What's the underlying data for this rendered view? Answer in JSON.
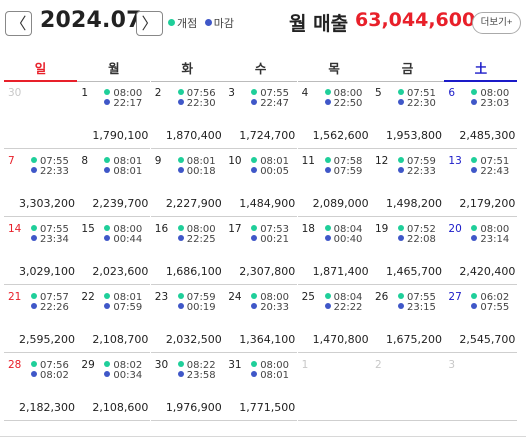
{
  "header": {
    "prev_label": "〈",
    "next_label": "〉",
    "month": "2024.07",
    "legend": {
      "open_label": "개점",
      "close_label": "마감",
      "open_color": "#1fcf9a",
      "close_color": "#3f57c8"
    },
    "sales_label": "월 매출",
    "sales_value": "63,044,600",
    "more_label": "더보기+"
  },
  "weekdays": [
    "일",
    "월",
    "화",
    "수",
    "목",
    "금",
    "土"
  ],
  "weeks": [
    [
      {
        "day": "30",
        "other": true
      },
      {
        "day": "1",
        "open": "08:00",
        "close": "22:17",
        "amount": "1,790,100"
      },
      {
        "day": "2",
        "open": "07:56",
        "close": "22:30",
        "amount": "1,870,400"
      },
      {
        "day": "3",
        "open": "07:55",
        "close": "22:47",
        "amount": "1,724,700"
      },
      {
        "day": "4",
        "open": "08:00",
        "close": "22:50",
        "amount": "1,562,600"
      },
      {
        "day": "5",
        "open": "07:51",
        "close": "22:30",
        "amount": "1,953,800"
      },
      {
        "day": "6",
        "open": "08:00",
        "close": "23:03",
        "amount": "2,485,300"
      }
    ],
    [
      {
        "day": "7",
        "open": "07:55",
        "close": "22:33",
        "amount": "3,303,200"
      },
      {
        "day": "8",
        "open": "08:01",
        "close": "08:01",
        "amount": "2,239,700"
      },
      {
        "day": "9",
        "open": "08:01",
        "close": "00:18",
        "amount": "2,227,900"
      },
      {
        "day": "10",
        "open": "08:01",
        "close": "00:05",
        "amount": "1,484,900"
      },
      {
        "day": "11",
        "open": "07:58",
        "close": "07:59",
        "amount": "2,089,000"
      },
      {
        "day": "12",
        "open": "07:59",
        "close": "22:33",
        "amount": "1,498,200"
      },
      {
        "day": "13",
        "open": "07:51",
        "close": "22:43",
        "amount": "2,179,200"
      }
    ],
    [
      {
        "day": "14",
        "open": "07:55",
        "close": "23:34",
        "amount": "3,029,100"
      },
      {
        "day": "15",
        "open": "08:00",
        "close": "00:44",
        "amount": "2,023,600"
      },
      {
        "day": "16",
        "open": "08:00",
        "close": "22:25",
        "amount": "1,686,100"
      },
      {
        "day": "17",
        "open": "07:53",
        "close": "00:21",
        "amount": "2,307,800"
      },
      {
        "day": "18",
        "open": "08:04",
        "close": "00:40",
        "amount": "1,871,400"
      },
      {
        "day": "19",
        "open": "07:52",
        "close": "22:08",
        "amount": "1,465,700"
      },
      {
        "day": "20",
        "open": "08:00",
        "close": "23:14",
        "amount": "2,420,400"
      }
    ],
    [
      {
        "day": "21",
        "open": "07:57",
        "close": "22:26",
        "amount": "2,595,200"
      },
      {
        "day": "22",
        "open": "08:01",
        "close": "07:59",
        "amount": "2,108,700"
      },
      {
        "day": "23",
        "open": "07:59",
        "close": "00:19",
        "amount": "2,032,500"
      },
      {
        "day": "24",
        "open": "08:00",
        "close": "20:33",
        "amount": "1,364,100"
      },
      {
        "day": "25",
        "open": "08:04",
        "close": "22:22",
        "amount": "1,470,800"
      },
      {
        "day": "26",
        "open": "07:55",
        "close": "23:15",
        "amount": "1,675,200"
      },
      {
        "day": "27",
        "open": "06:02",
        "close": "07:55",
        "amount": "2,545,700"
      }
    ],
    [
      {
        "day": "28",
        "open": "07:56",
        "close": "08:02",
        "amount": "2,182,300"
      },
      {
        "day": "29",
        "open": "08:02",
        "close": "00:34",
        "amount": "2,108,600"
      },
      {
        "day": "30",
        "open": "08:22",
        "close": "23:58",
        "amount": "1,976,900"
      },
      {
        "day": "31",
        "open": "08:00",
        "close": "08:01",
        "amount": "1,771,500"
      },
      {
        "day": "1",
        "other": true
      },
      {
        "day": "2",
        "other": true
      },
      {
        "day": "3",
        "other": true
      }
    ]
  ],
  "colors": {
    "sunday": "#e8202a",
    "saturday": "#1a1ac8",
    "sales_accent": "#e8202a"
  }
}
